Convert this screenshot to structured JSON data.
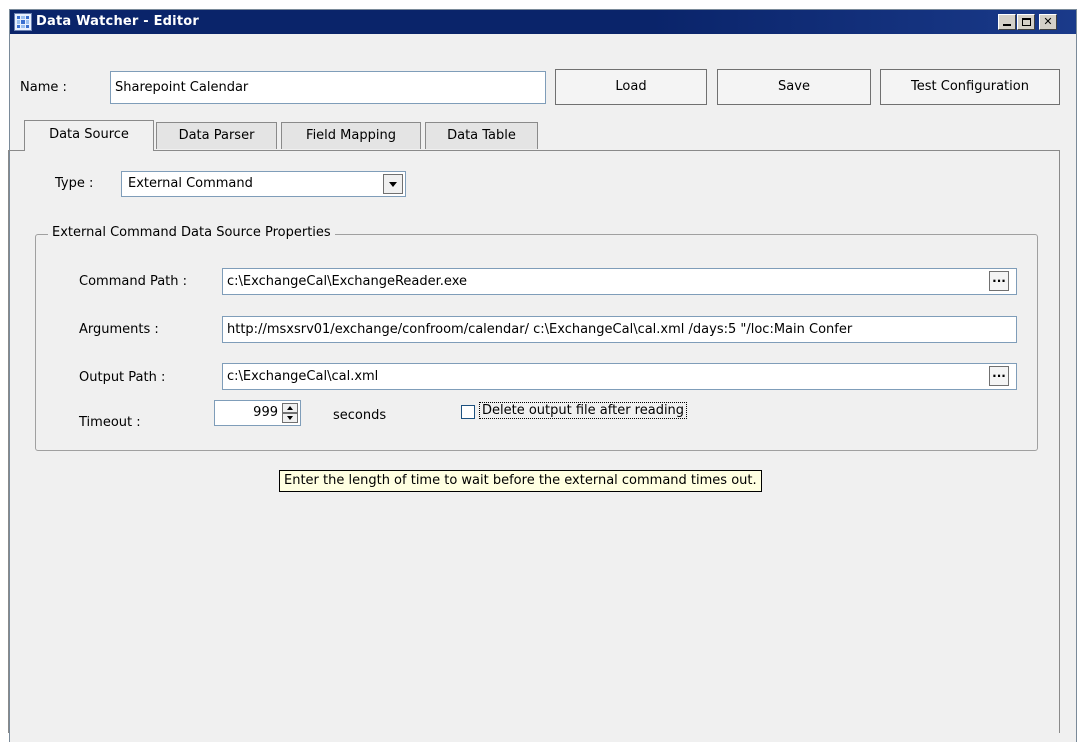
{
  "window": {
    "title": "Data Watcher - Editor",
    "colors": {
      "titlebar": "#0a246a",
      "face": "#f0f0f0",
      "tooltip": "#ffffe1"
    }
  },
  "header": {
    "name_label": "Name :",
    "name_value": "Sharepoint Calendar",
    "load_label": "Load",
    "save_label": "Save",
    "test_label": "Test Configuration"
  },
  "tabs": [
    {
      "label": "Data Source",
      "active": true
    },
    {
      "label": "Data Parser",
      "active": false
    },
    {
      "label": "Field Mapping",
      "active": false
    },
    {
      "label": "Data Table",
      "active": false
    }
  ],
  "data_source": {
    "type_label": "Type :",
    "type_value": "External Command",
    "group_title": "External Command Data Source Properties",
    "command_path_label": "Command Path :",
    "command_path_value": "c:\\ExchangeCal\\ExchangeReader.exe",
    "arguments_label": "Arguments :",
    "arguments_value": "http://msxsrv01/exchange/confroom/calendar/ c:\\ExchangeCal\\cal.xml /days:5 \"/loc:Main Confer",
    "output_path_label": "Output Path :",
    "output_path_value": "c:\\ExchangeCal\\cal.xml",
    "timeout_label": "Timeout :",
    "timeout_value": "999",
    "timeout_unit": "seconds",
    "delete_label": "Delete output file after reading",
    "delete_checked": false,
    "browse_glyph": "..."
  },
  "tooltip": {
    "text": "Enter the length of time to wait before the external command times out."
  }
}
